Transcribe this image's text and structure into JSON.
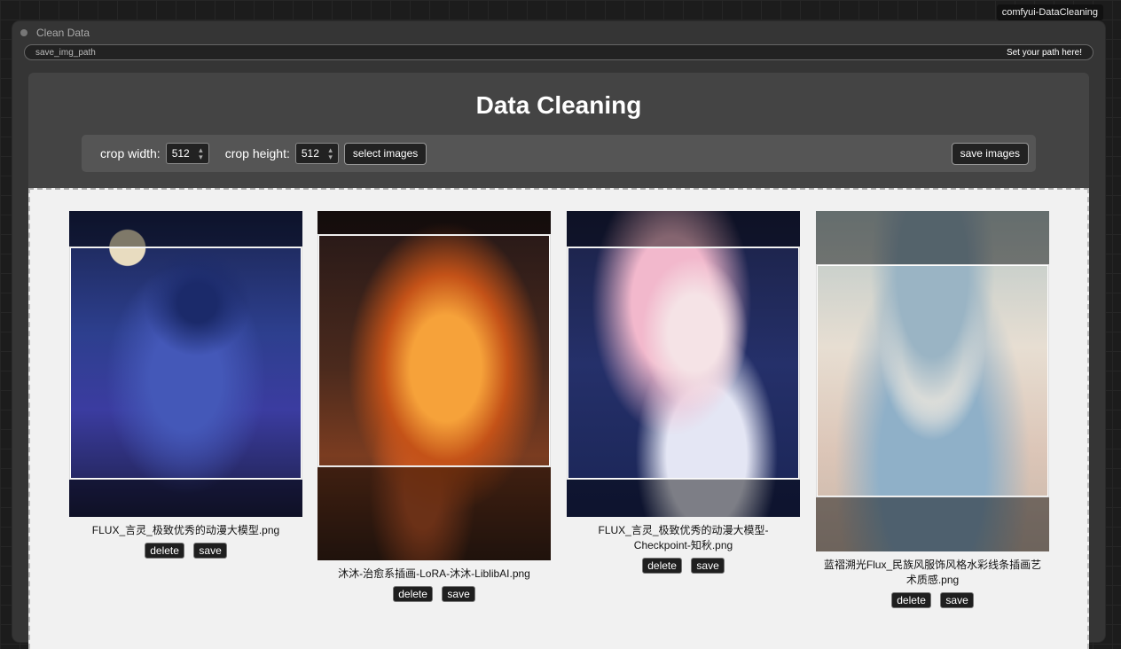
{
  "badge": "comfyui-DataCleaning",
  "node": {
    "title": "Clean Data",
    "widget_name": "save_img_path",
    "widget_value": "Set your path here!"
  },
  "panel": {
    "heading": "Data Cleaning",
    "crop_width_label": "crop width:",
    "crop_width_value": "512",
    "crop_height_label": "crop height:",
    "crop_height_value": "512",
    "select_images_label": "select images",
    "save_images_label": "save images"
  },
  "images": [
    {
      "caption": "FLUX_言灵_极致优秀的动漫大模型.png",
      "delete_label": "delete",
      "save_label": "save"
    },
    {
      "caption": "沐沐-治愈系插画-LoRA-沐沐-LiblibAI.png",
      "delete_label": "delete",
      "save_label": "save"
    },
    {
      "caption": "FLUX_言灵_极致优秀的动漫大模型-Checkpoint-知秋.png",
      "delete_label": "delete",
      "save_label": "save"
    },
    {
      "caption": "蓝褶溯光Flux_民族风服饰风格水彩线条插画艺术质感.png",
      "delete_label": "delete",
      "save_label": "save"
    }
  ]
}
